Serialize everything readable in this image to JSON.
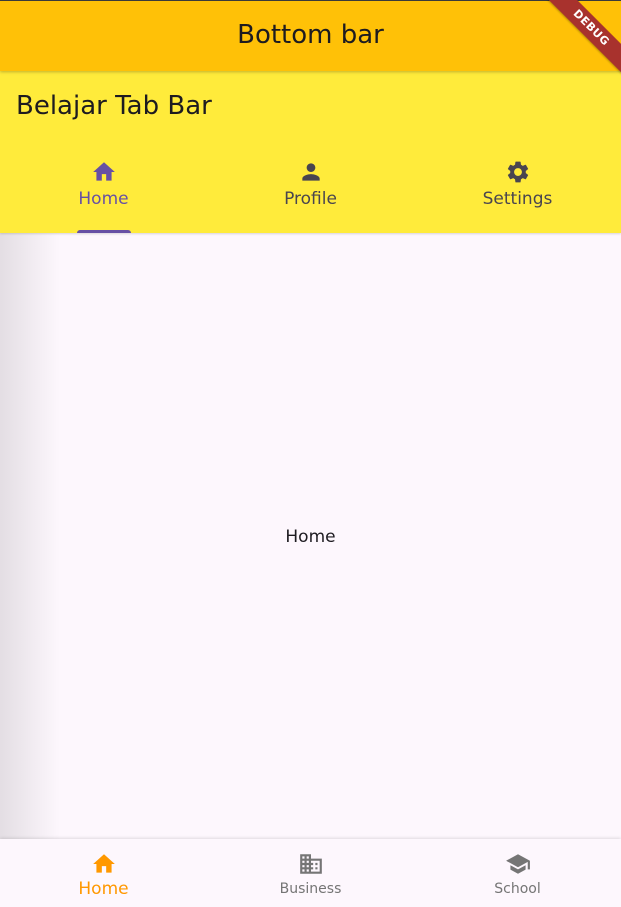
{
  "app_bar": {
    "title": "Bottom bar",
    "background": "#ffc107",
    "debug_banner": "DEBUG"
  },
  "tab_screen": {
    "title": "Belajar Tab Bar",
    "background": "#ffeb3b",
    "tabs": [
      {
        "label": "Home",
        "icon": "home-icon",
        "selected": true
      },
      {
        "label": "Profile",
        "icon": "person-icon",
        "selected": false
      },
      {
        "label": "Settings",
        "icon": "gear-icon",
        "selected": false
      }
    ],
    "active_color": "#6750a4",
    "inactive_color": "#49454f"
  },
  "content": {
    "text": "Home"
  },
  "bottom_nav": {
    "items": [
      {
        "label": "Home",
        "icon": "home-icon",
        "selected": true
      },
      {
        "label": "Business",
        "icon": "business-icon",
        "selected": false
      },
      {
        "label": "School",
        "icon": "school-icon",
        "selected": false
      }
    ],
    "active_color": "#ff9800",
    "inactive_color": "#757575"
  }
}
